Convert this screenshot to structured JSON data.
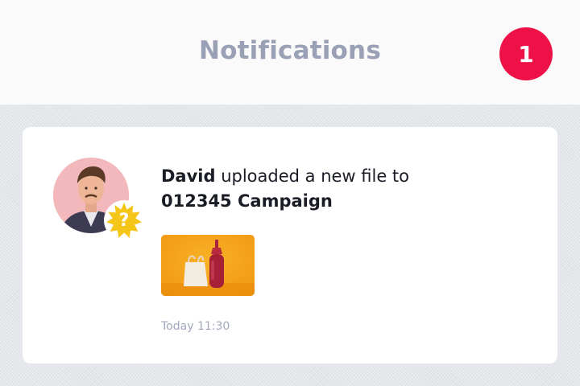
{
  "header": {
    "title": "Notifications",
    "badge_count": "1"
  },
  "notification": {
    "user": "David",
    "action": " uploaded a new file to",
    "target": "012345 Campaign",
    "status_symbol": "?",
    "timestamp": "Today 11:30",
    "icons": {
      "avatar": "user-avatar",
      "status": "question-badge-icon",
      "thumbnail": "file-thumbnail-image"
    }
  },
  "colors": {
    "badge": "#ee1147",
    "status_badge": "#f5c518",
    "title": "#9aa0b5",
    "thumbnail_bg": "#f5a418"
  }
}
